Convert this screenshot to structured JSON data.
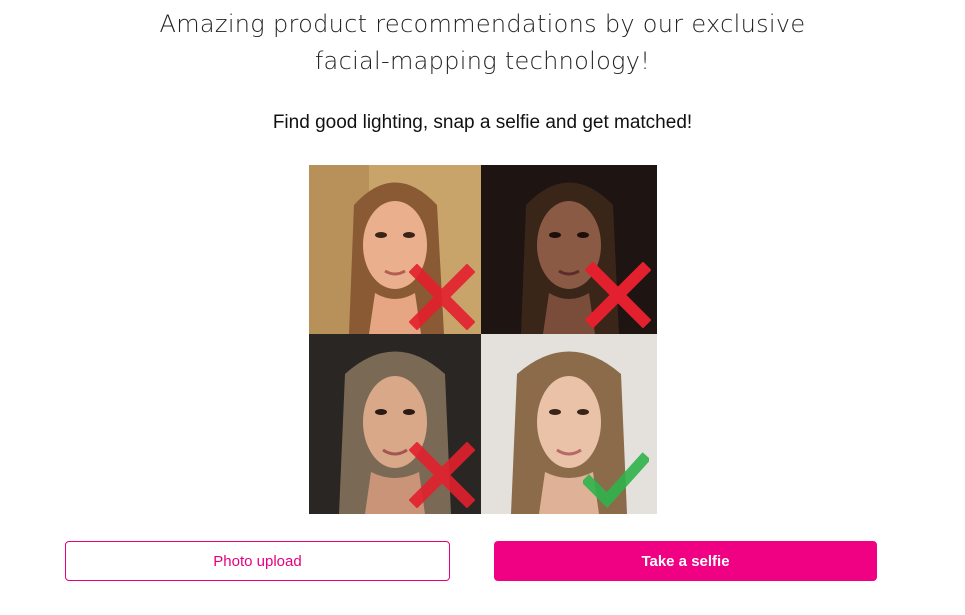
{
  "headline": {
    "line1": "Amazing product recommendations by our exclusive",
    "line2": "facial-mapping technology!"
  },
  "subheadline": "Find good lighting, snap a selfie and get matched!",
  "examples": [
    {
      "label": "overexposed-example",
      "verdict": "cross-mark-icon",
      "bg": "#c9a46a"
    },
    {
      "label": "dark-example",
      "verdict": "cross-mark-icon",
      "bg": "#1e1412"
    },
    {
      "label": "shadowed-example",
      "verdict": "cross-mark-icon",
      "bg": "#2a2623"
    },
    {
      "label": "good-lighting-example",
      "verdict": "check-mark-icon",
      "bg": "#e4e1dc"
    }
  ],
  "colors": {
    "accent": "#f00083",
    "cross": "#e3202d",
    "check": "#2fb24a"
  },
  "buttons": {
    "upload_label": "Photo upload",
    "selfie_label": "Take a selfie"
  }
}
